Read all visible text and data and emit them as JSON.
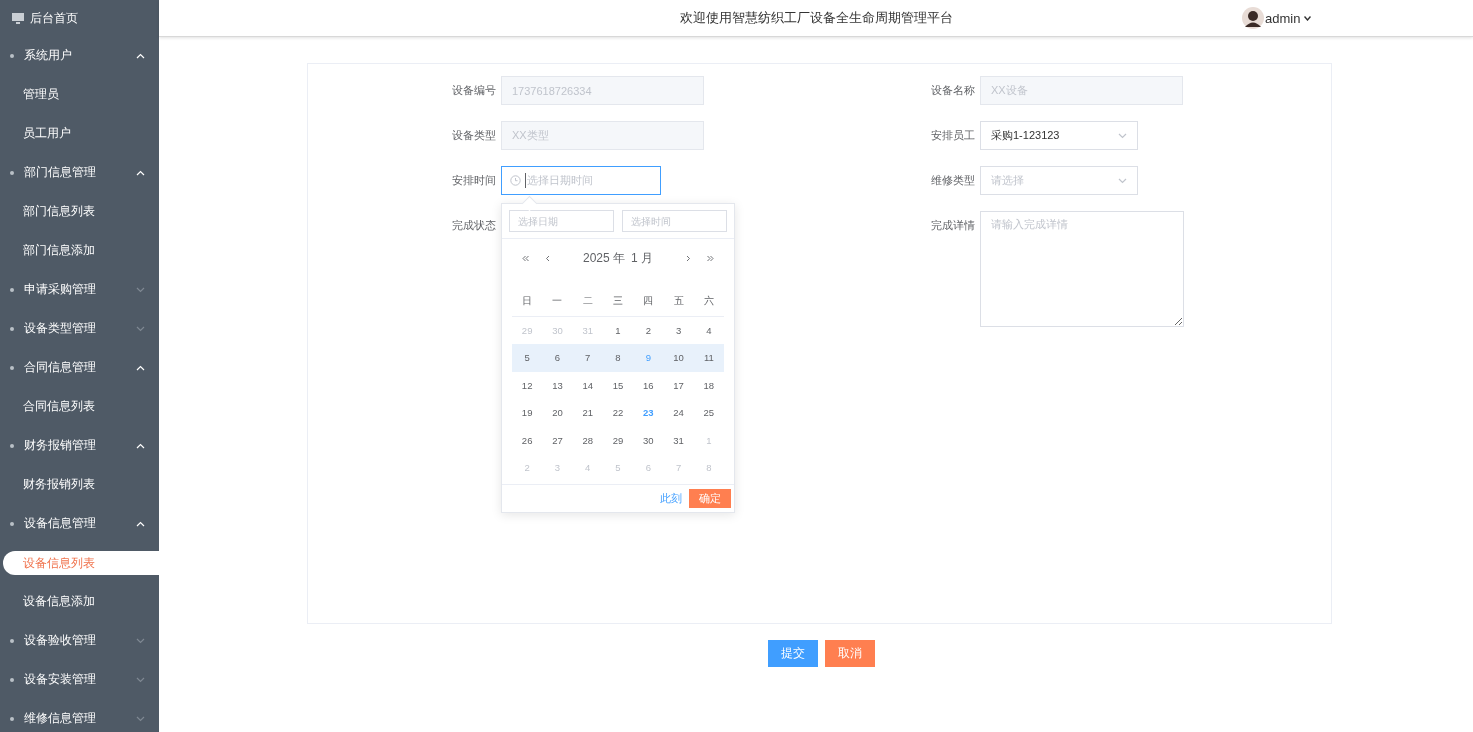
{
  "sidebar": {
    "home": "后台首页",
    "groups": [
      {
        "label": "系统用户",
        "expanded": true,
        "children": [
          {
            "label": "管理员",
            "selected": false
          },
          {
            "label": "员工用户",
            "selected": false
          }
        ]
      },
      {
        "label": "部门信息管理",
        "expanded": true,
        "children": [
          {
            "label": "部门信息列表",
            "selected": false
          },
          {
            "label": "部门信息添加",
            "selected": false
          }
        ]
      },
      {
        "label": "申请采购管理",
        "expanded": false
      },
      {
        "label": "设备类型管理",
        "expanded": false
      },
      {
        "label": "合同信息管理",
        "expanded": true,
        "children": [
          {
            "label": "合同信息列表",
            "selected": false
          }
        ]
      },
      {
        "label": "财务报销管理",
        "expanded": true,
        "children": [
          {
            "label": "财务报销列表",
            "selected": false
          }
        ]
      },
      {
        "label": "设备信息管理",
        "expanded": true,
        "children": [
          {
            "label": "设备信息列表",
            "selected": true
          },
          {
            "label": "设备信息添加",
            "selected": false
          }
        ]
      },
      {
        "label": "设备验收管理",
        "expanded": false
      },
      {
        "label": "设备安装管理",
        "expanded": false
      },
      {
        "label": "维修信息管理",
        "expanded": false
      }
    ]
  },
  "header": {
    "title": "欢迎使用智慧纺织工厂设备全生命周期管理平台",
    "user": "admin"
  },
  "form": {
    "fields": [
      {
        "label": "设备编号",
        "kind": "input",
        "value": "1737618726334",
        "disabled": true
      },
      {
        "label": "设备名称",
        "kind": "input",
        "value": "XX设备",
        "disabled": true
      },
      {
        "label": "设备类型",
        "kind": "input",
        "value": "XX类型",
        "disabled": true
      },
      {
        "label": "安排员工",
        "kind": "select",
        "value": "采购1-123123"
      },
      {
        "label": "安排时间",
        "kind": "datetime",
        "placeholder": "选择日期时间",
        "focused": true
      },
      {
        "label": "维修类型",
        "kind": "select",
        "placeholder": "请选择"
      },
      {
        "label": "完成状态",
        "kind": "covered"
      },
      {
        "label": "完成详情",
        "kind": "textarea",
        "placeholder": "请输入完成详情"
      }
    ],
    "picker": {
      "date_placeholder": "选择日期",
      "time_placeholder": "选择时间",
      "year": "2025 年",
      "month": "1 月",
      "weekdays": [
        "日",
        "一",
        "二",
        "三",
        "四",
        "五",
        "六"
      ],
      "weeks": [
        {
          "hovered": false,
          "days": [
            {
              "text": "29",
              "kind": "other"
            },
            {
              "text": "30",
              "kind": "other"
            },
            {
              "text": "31",
              "kind": "other"
            },
            {
              "text": "1",
              "kind": "normal"
            },
            {
              "text": "2",
              "kind": "normal"
            },
            {
              "text": "3",
              "kind": "normal"
            },
            {
              "text": "4",
              "kind": "normal"
            }
          ]
        },
        {
          "hovered": true,
          "days": [
            {
              "text": "5",
              "kind": "normal"
            },
            {
              "text": "6",
              "kind": "normal"
            },
            {
              "text": "7",
              "kind": "normal"
            },
            {
              "text": "8",
              "kind": "normal"
            },
            {
              "text": "9",
              "kind": "marked"
            },
            {
              "text": "10",
              "kind": "normal"
            },
            {
              "text": "11",
              "kind": "normal"
            }
          ]
        },
        {
          "hovered": false,
          "days": [
            {
              "text": "12",
              "kind": "normal"
            },
            {
              "text": "13",
              "kind": "normal"
            },
            {
              "text": "14",
              "kind": "normal"
            },
            {
              "text": "15",
              "kind": "normal"
            },
            {
              "text": "16",
              "kind": "normal"
            },
            {
              "text": "17",
              "kind": "normal"
            },
            {
              "text": "18",
              "kind": "normal"
            }
          ]
        },
        {
          "hovered": false,
          "days": [
            {
              "text": "19",
              "kind": "normal"
            },
            {
              "text": "20",
              "kind": "normal"
            },
            {
              "text": "21",
              "kind": "normal"
            },
            {
              "text": "22",
              "kind": "normal"
            },
            {
              "text": "23",
              "kind": "today"
            },
            {
              "text": "24",
              "kind": "normal"
            },
            {
              "text": "25",
              "kind": "normal"
            }
          ]
        },
        {
          "hovered": false,
          "days": [
            {
              "text": "26",
              "kind": "normal"
            },
            {
              "text": "27",
              "kind": "normal"
            },
            {
              "text": "28",
              "kind": "normal"
            },
            {
              "text": "29",
              "kind": "normal"
            },
            {
              "text": "30",
              "kind": "normal"
            },
            {
              "text": "31",
              "kind": "normal"
            },
            {
              "text": "1",
              "kind": "other"
            }
          ]
        },
        {
          "hovered": false,
          "days": [
            {
              "text": "2",
              "kind": "other"
            },
            {
              "text": "3",
              "kind": "other"
            },
            {
              "text": "4",
              "kind": "other"
            },
            {
              "text": "5",
              "kind": "other"
            },
            {
              "text": "6",
              "kind": "other"
            },
            {
              "text": "7",
              "kind": "other"
            },
            {
              "text": "8",
              "kind": "other"
            }
          ]
        }
      ],
      "now": "此刻",
      "confirm": "确定"
    }
  },
  "actions": [
    {
      "label": "提交",
      "kind": "primary"
    },
    {
      "label": "取消",
      "kind": "cancel"
    }
  ]
}
